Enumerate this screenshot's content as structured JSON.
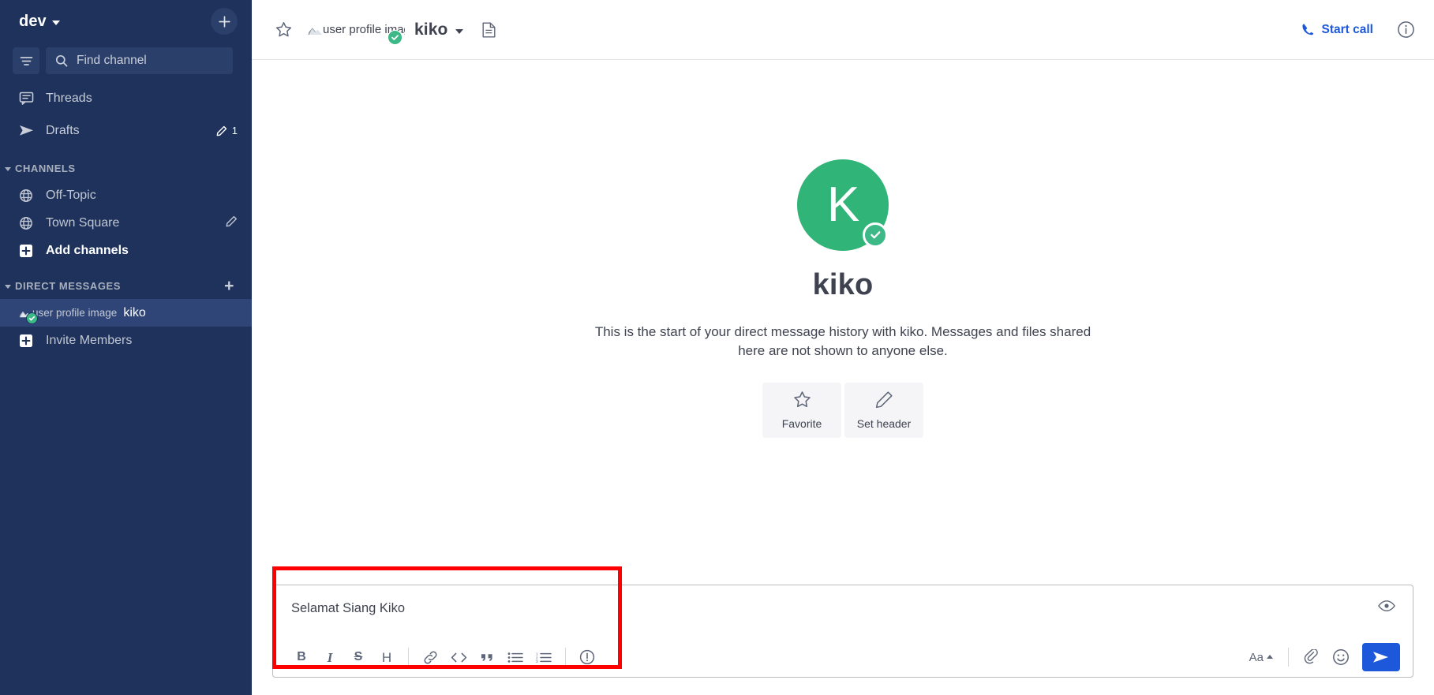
{
  "sidebar": {
    "team_name": "dev",
    "add_button_icon": "plus-icon",
    "filter_icon": "filter-icon",
    "search": {
      "placeholder": "Find channel",
      "icon": "search-icon"
    },
    "nav_items": [
      {
        "label": "Threads",
        "icon": "threads-icon",
        "badge": ""
      },
      {
        "label": "Drafts",
        "icon": "send-icon",
        "badge": "1",
        "badge_icon": "pencil-icon"
      }
    ],
    "channels_category": {
      "title": "CHANNELS",
      "items": [
        {
          "label": "Off-Topic",
          "icon": "globe-icon",
          "action_icon": ""
        },
        {
          "label": "Town Square",
          "icon": "globe-icon",
          "action_icon": "pencil-icon"
        },
        {
          "label": "Add channels",
          "icon": "plus-box-icon",
          "action_icon": ""
        }
      ]
    },
    "dm_category": {
      "title": "DIRECT MESSAGES",
      "add_icon": "plus-icon",
      "items": [
        {
          "label": "kiko",
          "avatar_alt": "user profile image",
          "status": "online",
          "active": true
        },
        {
          "label": "Invite Members",
          "icon": "plus-box-icon",
          "active": false
        }
      ]
    }
  },
  "header": {
    "star_icon": "star-icon",
    "avatar_alt": "user profile image",
    "title": "kiko",
    "chevron_icon": "chevron-down-icon",
    "file_icon": "file-icon",
    "start_call_label": "Start call",
    "call_icon": "phone-icon",
    "info_icon": "info-icon"
  },
  "intro": {
    "avatar_initial": "K",
    "avatar_color": "#30b477",
    "status": "online",
    "name": "kiko",
    "description": "This is the start of your direct message history with kiko. Messages and files shared here are not shown to anyone else.",
    "actions": [
      {
        "label": "Favorite",
        "icon": "star-icon"
      },
      {
        "label": "Set header",
        "icon": "pencil-icon"
      }
    ]
  },
  "composer": {
    "message_value": "Selamat Siang Kiko",
    "preview_icon": "eye-icon",
    "format_buttons": [
      {
        "name": "bold",
        "glyph": "B"
      },
      {
        "name": "italic",
        "glyph": "I"
      },
      {
        "name": "strikethrough",
        "glyph": "S"
      },
      {
        "name": "heading",
        "glyph": "H"
      },
      {
        "name": "link",
        "glyph": "link"
      },
      {
        "name": "code",
        "glyph": "<>"
      },
      {
        "name": "quote",
        "glyph": "“"
      },
      {
        "name": "bulleted-list",
        "glyph": "list"
      },
      {
        "name": "ordered-list",
        "glyph": "olist"
      },
      {
        "name": "help",
        "glyph": "info"
      }
    ],
    "text_format_label": "Aa",
    "attach_icon": "paperclip-icon",
    "emoji_icon": "emoji-icon",
    "send_icon": "send-icon"
  },
  "annotation": {
    "highlight_color": "#ff0000"
  }
}
